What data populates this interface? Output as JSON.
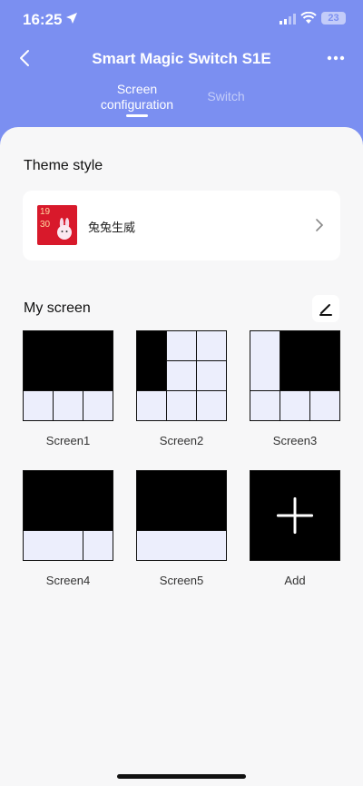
{
  "status_bar": {
    "time": "16:25",
    "battery": "23"
  },
  "nav": {
    "title": "Smart Magic Switch S1E"
  },
  "tabs": [
    {
      "label_line1": "Screen",
      "label_line2": "configuration"
    },
    {
      "label": "Switch"
    }
  ],
  "theme": {
    "section_title": "Theme style",
    "name": "兔兔生威",
    "thumb_top": "19",
    "thumb_bottom": "30"
  },
  "my_screen": {
    "section_title": "My screen",
    "screens": [
      {
        "label": "Screen1"
      },
      {
        "label": "Screen2"
      },
      {
        "label": "Screen3"
      },
      {
        "label": "Screen4"
      },
      {
        "label": "Screen5"
      },
      {
        "label": "Add"
      }
    ]
  },
  "colors": {
    "header": "#7b8ff1",
    "cell": "#eceefc"
  }
}
